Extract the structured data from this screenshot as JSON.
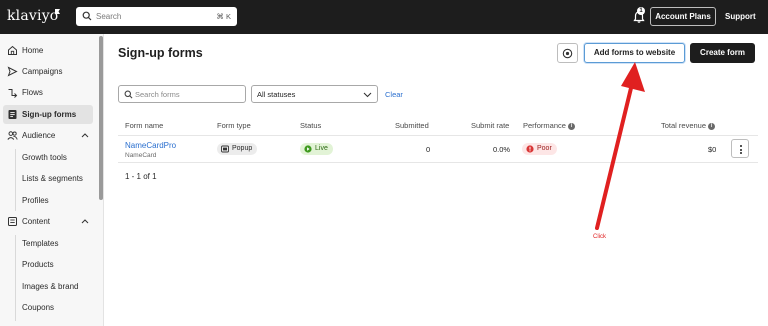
{
  "topbar": {
    "logo": "klaviyo",
    "search_placeholder": "Search",
    "search_shortcut": "⌘ K",
    "notification_count": "1",
    "account_plans_label": "Account Plans",
    "support_label": "Support"
  },
  "sidebar": {
    "items": [
      {
        "label": "Home",
        "icon": "home-icon"
      },
      {
        "label": "Campaigns",
        "icon": "send-icon"
      },
      {
        "label": "Flows",
        "icon": "flow-icon"
      },
      {
        "label": "Sign-up forms",
        "icon": "form-icon",
        "active": true
      },
      {
        "label": "Audience",
        "icon": "audience-icon",
        "expanded": true
      },
      {
        "label": "Content",
        "icon": "content-icon",
        "expanded": true
      }
    ],
    "audience_children": [
      "Growth tools",
      "Lists & segments",
      "Profiles"
    ],
    "content_children": [
      "Templates",
      "Products",
      "Images & brand",
      "Coupons"
    ]
  },
  "page": {
    "title": "Sign-up forms",
    "add_forms_label": "Add forms to website",
    "create_form_label": "Create form"
  },
  "filters": {
    "search_placeholder": "Search forms",
    "status_value": "All statuses",
    "clear_label": "Clear"
  },
  "table": {
    "headers": [
      "Form name",
      "Form type",
      "Status",
      "Submitted",
      "Submit rate",
      "Performance",
      "Total revenue"
    ],
    "rows": [
      {
        "name": "NameCardPro",
        "subtitle": "NameCard",
        "type": "Popup",
        "status": "Live",
        "submitted": "0",
        "submit_rate": "0.0%",
        "performance": "Poor",
        "revenue": "$0"
      }
    ],
    "pagination": "1 - 1 of 1"
  },
  "annotation": {
    "label": "Click",
    "color": "#e02020"
  },
  "colors": {
    "topbar": "#1d1d1d",
    "link": "#2a6fcf",
    "live_bg": "#e2f3d6",
    "poor_bg": "#fde6e6"
  }
}
